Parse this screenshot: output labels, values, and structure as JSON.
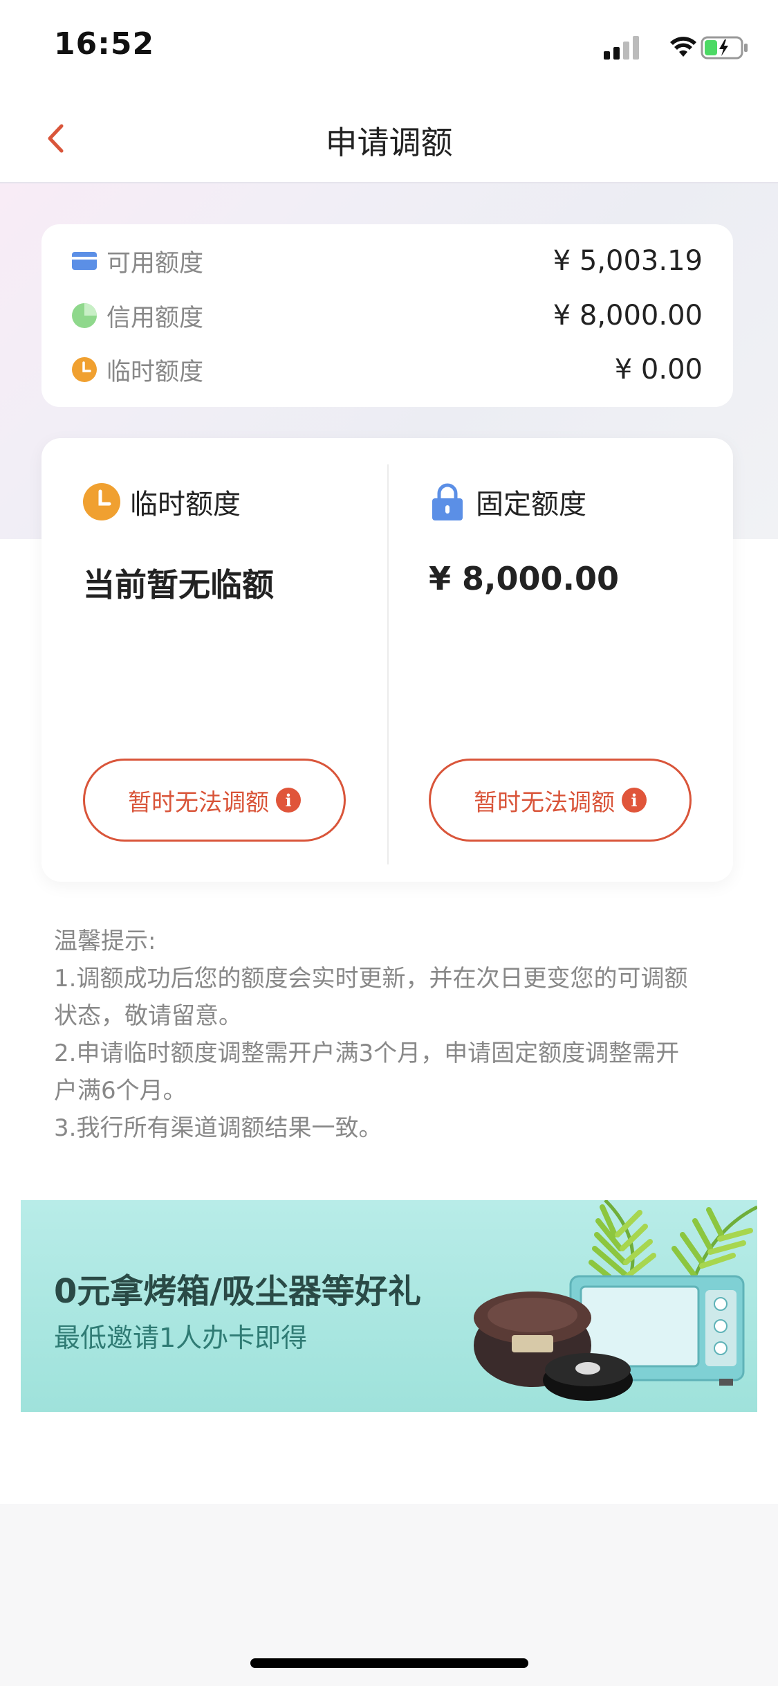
{
  "status_bar": {
    "time": "16:52"
  },
  "nav": {
    "title": "申请调额"
  },
  "summary": {
    "rows": [
      {
        "label": "可用额度",
        "value": "¥ 5,003.19",
        "icon": "card-icon"
      },
      {
        "label": "信用额度",
        "value": "¥ 8,000.00",
        "icon": "pie-icon"
      },
      {
        "label": "临时额度",
        "value": "¥ 0.00",
        "icon": "clock-icon"
      }
    ]
  },
  "limits": {
    "temporary": {
      "title": "临时额度",
      "value": "当前暂无临额",
      "button": "暂时无法调额",
      "icon": "clock-icon"
    },
    "fixed": {
      "title": "固定额度",
      "value": "¥ 8,000.00",
      "button": "暂时无法调额",
      "icon": "lock-icon"
    }
  },
  "tips": {
    "heading": "温馨提示:",
    "line1": "1.调额成功后您的额度会实时更新，并在次日更变您的可调额",
    "line1b": "状态，敬请留意。",
    "line2": "2.申请临时额度调整需开户满3个月，申请固定额度调整需开",
    "line2b": "户满6个月。",
    "line3": "3.我行所有渠道调额结果一致。"
  },
  "banner": {
    "title": "0元拿烤箱/吸尘器等好礼",
    "subtitle": "最低邀请1人办卡即得"
  },
  "colors": {
    "accent": "#d9553a",
    "orange": "#f0a030",
    "blue": "#5b8fe6",
    "green": "#8fd88c",
    "banner_bg": "#a9e6df"
  }
}
